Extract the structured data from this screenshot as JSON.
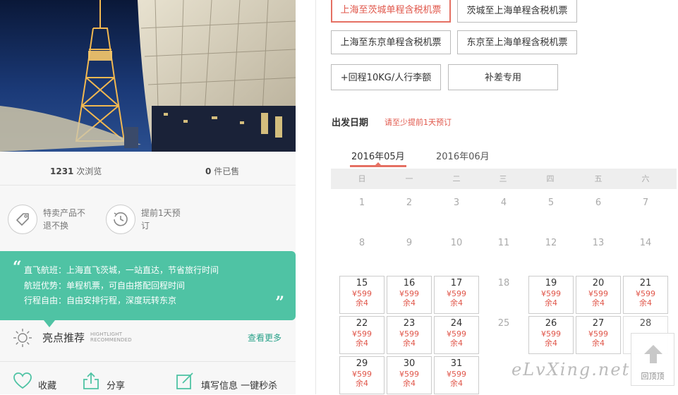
{
  "stats": {
    "views_count": "1231",
    "views_label": "次浏览",
    "sold_count": "0",
    "sold_label": "件已售"
  },
  "features": [
    {
      "icon": "tag-icon",
      "text_line1": "特卖产品不",
      "text_line2": "退不换"
    },
    {
      "icon": "clock-icon",
      "text_line1": "提前1天预",
      "text_line2": "订"
    }
  ],
  "promo": {
    "open_quote": "“",
    "close_quote": "”",
    "lines": [
      "直飞航班：上海直飞茨城，一站直达，节省旅行时间",
      "航班优势：单程机票，可自由搭配回程时间",
      "行程自由：自由安排行程，深度玩转东京"
    ]
  },
  "highlight": {
    "title": "亮点推荐",
    "en_line1": "HIGHTLIGHT",
    "en_line2": "RECOMMENDED",
    "more": "查看更多"
  },
  "actions": {
    "favorite": "收藏",
    "share": "分享",
    "fill_info": "填写信息 一键秒杀"
  },
  "products": [
    {
      "label": "上海至茨城单程含税机票",
      "active": true
    },
    {
      "label": "茨城至上海单程含税机票",
      "active": false
    },
    {
      "label": "上海至东京单程含税机票",
      "active": false
    },
    {
      "label": "东京至上海单程含税机票",
      "active": false
    },
    {
      "label": "+回程10KG/人行李额",
      "active": false
    },
    {
      "label": "补差专用",
      "active": false
    }
  ],
  "departure": {
    "label": "出发日期",
    "hint": "请至少提前1天预订"
  },
  "months": [
    {
      "label": "2016年05月",
      "active": true
    },
    {
      "label": "2016年06月",
      "active": false
    }
  ],
  "weekdays": [
    "日",
    "一",
    "二",
    "三",
    "四",
    "五",
    "六"
  ],
  "calendar": {
    "plain_days": [
      "1",
      "2",
      "3",
      "4",
      "5",
      "6",
      "7",
      "8",
      "9",
      "10",
      "11",
      "12",
      "13",
      "14",
      "18",
      "25",
      "28"
    ],
    "priced_days": [
      {
        "day": "15",
        "price": "¥599",
        "remain": "余4"
      },
      {
        "day": "16",
        "price": "¥599",
        "remain": "余4"
      },
      {
        "day": "17",
        "price": "¥599",
        "remain": "余4"
      },
      {
        "day": "19",
        "price": "¥599",
        "remain": "余4"
      },
      {
        "day": "20",
        "price": "¥599",
        "remain": "余4"
      },
      {
        "day": "21",
        "price": "¥599",
        "remain": "余4"
      },
      {
        "day": "22",
        "price": "¥599",
        "remain": "余4"
      },
      {
        "day": "23",
        "price": "¥599",
        "remain": "余4"
      },
      {
        "day": "24",
        "price": "¥599",
        "remain": "余4"
      },
      {
        "day": "26",
        "price": "¥599",
        "remain": "余4"
      },
      {
        "day": "27",
        "price": "¥599",
        "remain": "余4"
      },
      {
        "day": "29",
        "price": "¥599",
        "remain": "余4"
      },
      {
        "day": "30",
        "price": "¥599",
        "remain": "余4"
      },
      {
        "day": "31",
        "price": "¥599",
        "remain": "余4"
      }
    ]
  },
  "back_to_top": "回顶顶",
  "watermark": "eLvXing.net",
  "colors": {
    "accent_red": "#e0564a",
    "promo_green": "#4fc3a4",
    "link_green": "#2aa28a"
  }
}
